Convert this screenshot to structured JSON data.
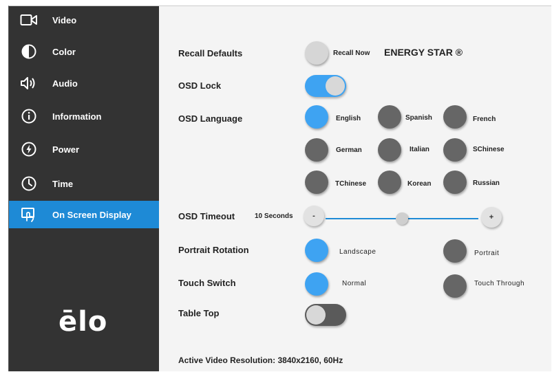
{
  "sidebar": {
    "items": [
      {
        "label": "Video",
        "icon": "video-camera-icon"
      },
      {
        "label": "Color",
        "icon": "contrast-icon"
      },
      {
        "label": "Audio",
        "icon": "speaker-icon"
      },
      {
        "label": "Information",
        "icon": "info-icon"
      },
      {
        "label": "Power",
        "icon": "power-icon"
      },
      {
        "label": "Time",
        "icon": "clock-icon"
      },
      {
        "label": "On Screen Display",
        "icon": "touch-screen-icon",
        "active": true
      }
    ],
    "logo": "ēlo"
  },
  "colors": {
    "sidebar_bg": "#333333",
    "accent": "#1e8ad6",
    "selected_radio": "#3ea3f2",
    "unselected_radio": "#666666"
  },
  "main": {
    "recall_defaults": {
      "label": "Recall Defaults",
      "button_label": "Recall Now",
      "energy_star": "ENERGY STAR ®"
    },
    "osd_lock": {
      "label": "OSD Lock",
      "on": true
    },
    "osd_language": {
      "label": "OSD Language",
      "selected": "English",
      "options": [
        "English",
        "Spanish",
        "French",
        "German",
        "Italian",
        "SChinese",
        "TChinese",
        "Korean",
        "Russian"
      ]
    },
    "osd_timeout": {
      "label": "OSD Timeout",
      "value_text": "10 Seconds",
      "minus": "-",
      "plus": "+",
      "level": 0.5
    },
    "portrait_rotation": {
      "label": "Portrait Rotation",
      "options": [
        "Landscape",
        "Portrait"
      ],
      "selected": "Landscape"
    },
    "touch_switch": {
      "label": "Touch Switch",
      "options": [
        "Normal",
        "Touch Through"
      ],
      "selected": "Normal"
    },
    "table_top": {
      "label": "Table Top",
      "on": false
    },
    "resolution": "Active Video Resolution: 3840x2160, 60Hz"
  }
}
